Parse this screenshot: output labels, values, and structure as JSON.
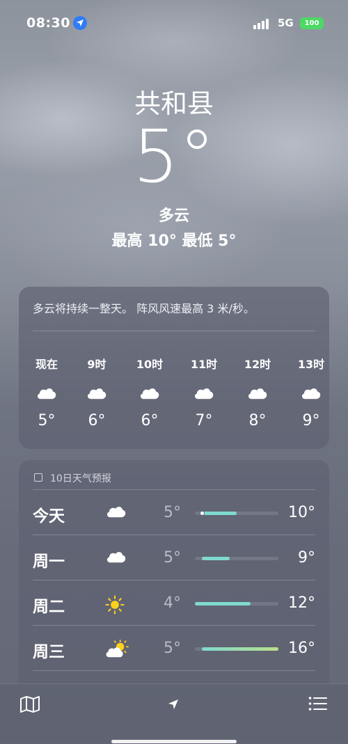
{
  "status": {
    "time": "08:30",
    "network": "5G",
    "battery": "100"
  },
  "weather": {
    "city": "共和县",
    "temperature": "5°",
    "condition": "多云",
    "high_low": "最高 10°  最低 5°"
  },
  "hourly": {
    "summary": "多云将持续一整天。 阵风风速最高 3 米/秒。",
    "items": [
      {
        "label": "现在",
        "icon": "cloud-icon",
        "temp": "5°"
      },
      {
        "label": "9时",
        "icon": "cloud-icon",
        "temp": "6°"
      },
      {
        "label": "10时",
        "icon": "cloud-icon",
        "temp": "6°"
      },
      {
        "label": "11时",
        "icon": "cloud-icon",
        "temp": "7°"
      },
      {
        "label": "12时",
        "icon": "cloud-icon",
        "temp": "8°"
      },
      {
        "label": "13时",
        "icon": "cloud-icon",
        "temp": "9°"
      }
    ]
  },
  "forecast": {
    "title": "10日天气预报",
    "range_min": 4,
    "range_max": 16,
    "days": [
      {
        "day": "今天",
        "icon": "cloud-icon",
        "low": "5°",
        "high": "10°",
        "low_value": 5,
        "high_value": 10,
        "current_value": 5
      },
      {
        "day": "周一",
        "icon": "cloud-icon",
        "low": "5°",
        "high": "9°",
        "low_value": 5,
        "high_value": 9
      },
      {
        "day": "周二",
        "icon": "sun-icon",
        "low": "4°",
        "high": "12°",
        "low_value": 4,
        "high_value": 12
      },
      {
        "day": "周三",
        "icon": "partly-cloudy-icon",
        "low": "5°",
        "high": "16°",
        "low_value": 5,
        "high_value": 16
      }
    ]
  },
  "colors": {
    "bar_fill": "#7fd9cf",
    "bar_fill_warm": "#b8e08a",
    "location_badge": "#2f7cf6",
    "battery": "#4cd964",
    "sun": "#ffd11a"
  }
}
